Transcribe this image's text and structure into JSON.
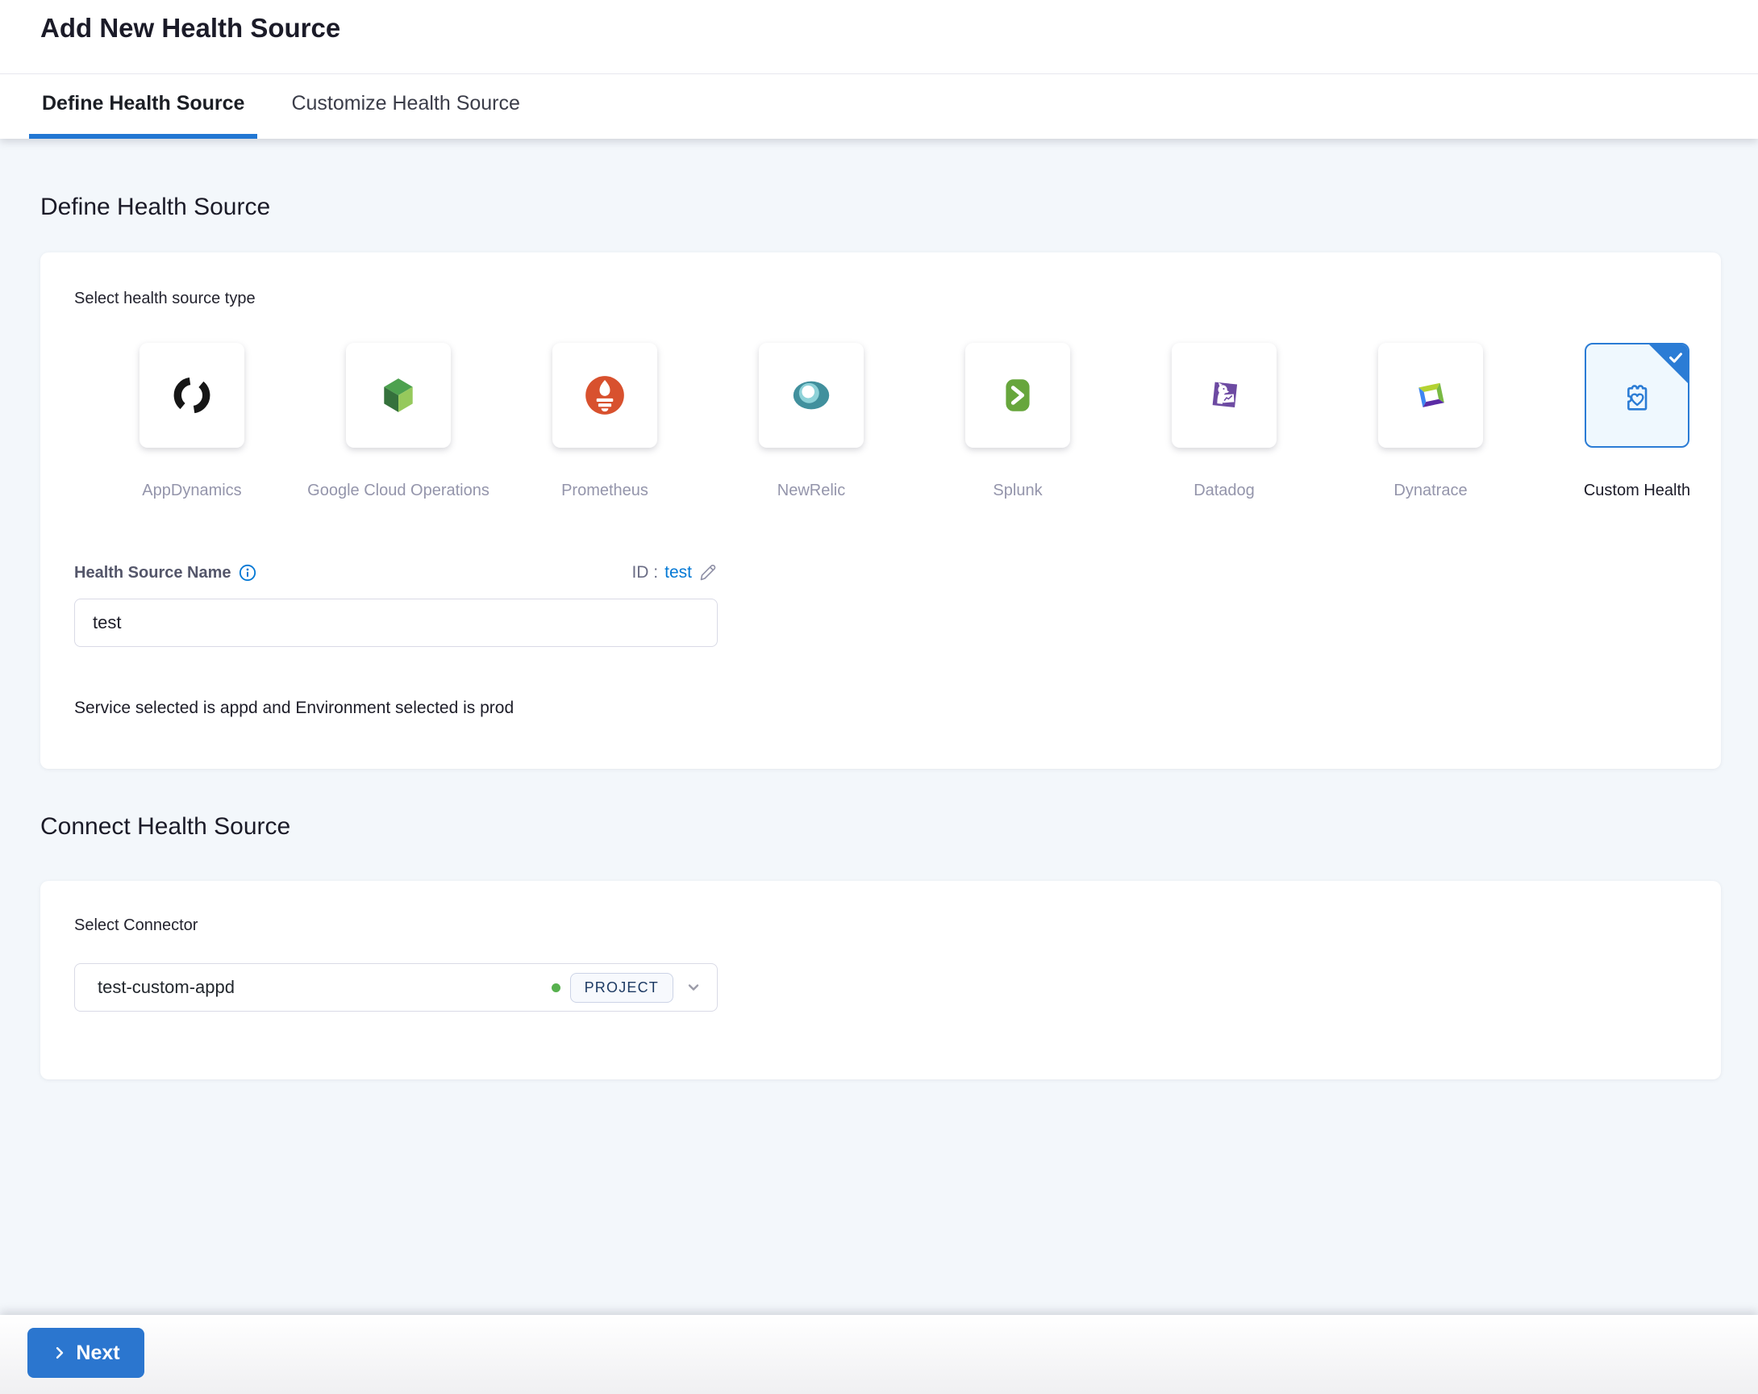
{
  "header": {
    "title": "Add New Health Source",
    "tabs": [
      {
        "label": "Define Health Source",
        "active": true
      },
      {
        "label": "Customize Health Source",
        "active": false
      }
    ]
  },
  "define_section": {
    "heading": "Define Health Source",
    "select_type_label": "Select health source type",
    "source_types": [
      {
        "name": "AppDynamics",
        "icon": "appdynamics-icon",
        "selected": false
      },
      {
        "name": "Google Cloud Operations",
        "icon": "google-cloud-operations-icon",
        "selected": false
      },
      {
        "name": "Prometheus",
        "icon": "prometheus-icon",
        "selected": false
      },
      {
        "name": "NewRelic",
        "icon": "newrelic-icon",
        "selected": false
      },
      {
        "name": "Splunk",
        "icon": "splunk-icon",
        "selected": false
      },
      {
        "name": "Datadog",
        "icon": "datadog-icon",
        "selected": false
      },
      {
        "name": "Dynatrace",
        "icon": "dynatrace-icon",
        "selected": false
      },
      {
        "name": "Custom Health",
        "icon": "custom-health-icon",
        "selected": true
      }
    ],
    "name_field": {
      "label": "Health Source Name",
      "id_prefix": "ID :",
      "id_value": "test",
      "value": "test"
    },
    "service_env_note": "Service selected is appd and Environment selected is prod"
  },
  "connect_section": {
    "heading": "Connect Health Source",
    "select_connector_label": "Select Connector",
    "connector": {
      "name": "test-custom-appd",
      "status": "connected",
      "scope_badge": "PROJECT"
    }
  },
  "footer": {
    "next_label": "Next"
  },
  "colors": {
    "accent_blue": "#0278d5",
    "tab_underline": "#2277d3",
    "next_button": "#2b76cf",
    "selected_tile_bg": "#eff8fe",
    "selected_tile_border": "#2b7cd5",
    "status_green": "#57b14e",
    "tile_label_gray": "#9495ab",
    "page_background": "#f3f7fb"
  }
}
